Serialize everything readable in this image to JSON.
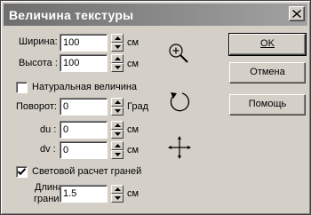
{
  "title": "Величина текстуры",
  "size": {
    "width_label": "Ширина:",
    "width_value": "100",
    "height_label": "Высота :",
    "height_value": "100",
    "unit": "см"
  },
  "natural_size": {
    "label": "Натуральная величина",
    "checked": false
  },
  "rotation": {
    "label": "Поворот:",
    "value": "0",
    "unit": "Град"
  },
  "offset": {
    "du_label": "du :",
    "du_value": "0",
    "dv_label": "dv :",
    "dv_value": "0",
    "unit": "см"
  },
  "edge_light": {
    "label": "Световой расчет граней",
    "checked": true
  },
  "edge_length": {
    "label_line1": "Длина",
    "label_line2": "грани:",
    "value": "1.5",
    "unit": "см"
  },
  "buttons": {
    "ok": "OK",
    "cancel": "Отмена",
    "help": "Помощь"
  },
  "tools": [
    "zoom-icon",
    "rotate-icon",
    "move-icon"
  ]
}
